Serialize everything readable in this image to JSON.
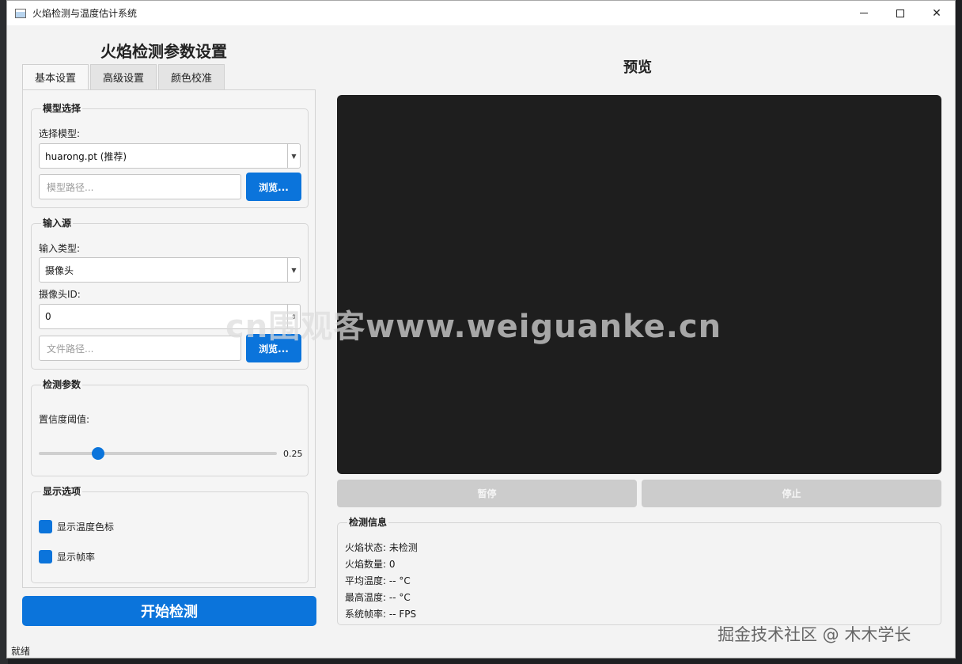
{
  "window": {
    "title": "火焰检测与温度估计系统"
  },
  "left": {
    "title": "火焰检测参数设置",
    "tabs": [
      "基本设置",
      "高级设置",
      "颜色校准"
    ],
    "model_group": {
      "title": "模型选择",
      "select_label": "选择模型:",
      "selected_model": "huarong.pt (推荐)",
      "path_placeholder": "模型路径...",
      "browse_label": "浏览..."
    },
    "input_group": {
      "title": "输入源",
      "type_label": "输入类型:",
      "selected_type": "摄像头",
      "camera_label": "摄像头ID:",
      "camera_id": "0",
      "file_placeholder": "文件路径...",
      "browse_label": "浏览..."
    },
    "detect_group": {
      "title": "检测参数",
      "conf_label": "置信度阈值:",
      "conf_value": "0.25",
      "conf_fraction": 0.25
    },
    "display_group": {
      "title": "显示选项",
      "options": [
        {
          "label": "显示温度色标",
          "checked": true
        },
        {
          "label": "显示帧率",
          "checked": true
        }
      ]
    },
    "start_label": "开始检测"
  },
  "right": {
    "preview_title": "预览",
    "pause_label": "暂停",
    "stop_label": "停止",
    "info": {
      "title": "检测信息",
      "lines": [
        "火焰状态: 未检测",
        "火焰数量: 0",
        "平均温度: -- °C",
        "最高温度: -- °C",
        "系统帧率: -- FPS"
      ]
    }
  },
  "status": "就绪",
  "overlay": {
    "watermark": "cn围观客www.weiguanke.cn",
    "credit": "掘金技术社区 @ 木木学长"
  },
  "colors": {
    "accent": "#0b74db",
    "preview_bg": "#1e1e1e",
    "disabled": "#cccccc"
  }
}
